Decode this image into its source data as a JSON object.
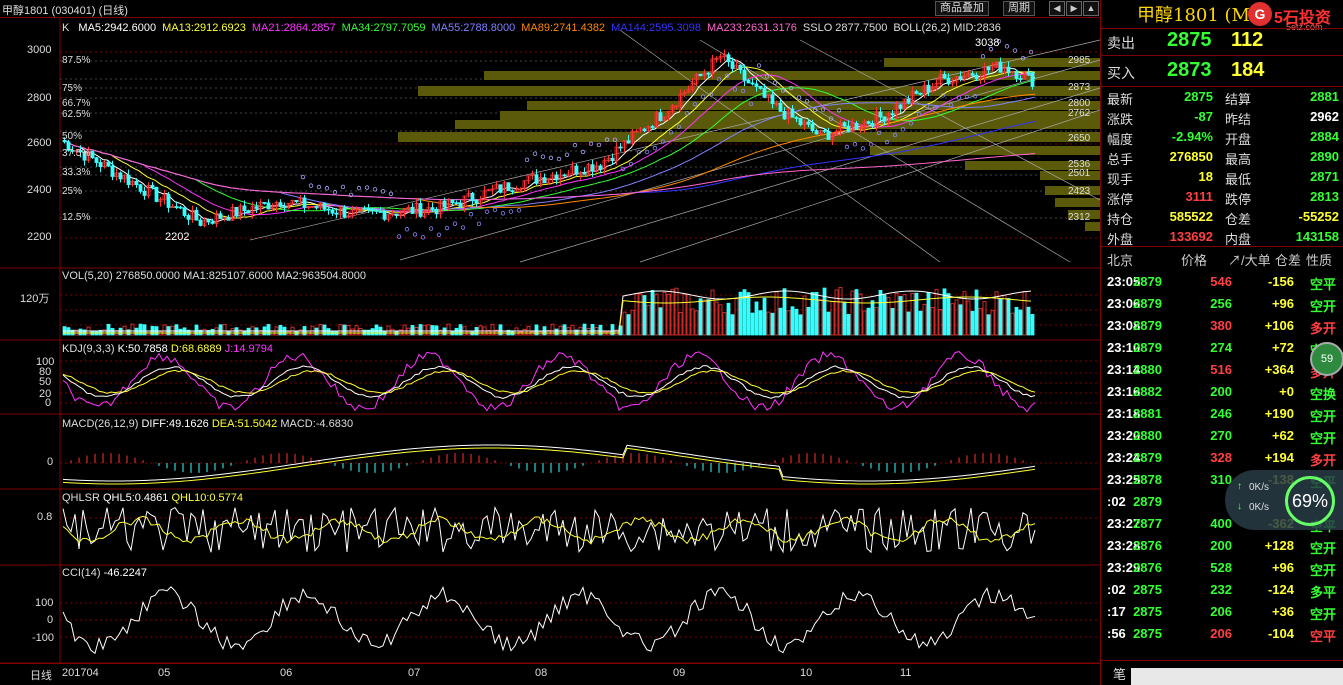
{
  "title_bar": {
    "title": "甲醇1801 (030401) (日线)",
    "buttons": [
      "商品叠加",
      "周期"
    ]
  },
  "kline": {
    "label": "K",
    "ma": [
      {
        "text": "MA5:2942.6000",
        "color": "#ffffff"
      },
      {
        "text": "MA13:2912.6923",
        "color": "#ffff33"
      },
      {
        "text": "MA21:2864.2857",
        "color": "#ff33ff"
      },
      {
        "text": "MA34:2797.7059",
        "color": "#33ff33"
      },
      {
        "text": "MA55:2788.8000",
        "color": "#8080ff"
      },
      {
        "text": "MA89:2741.4382",
        "color": "#ff8800"
      },
      {
        "text": "MA144:2595.3098",
        "color": "#3333ff"
      },
      {
        "text": "MA233:2631.3176",
        "color": "#ff66cc"
      },
      {
        "text": "SSLO 2877.7500",
        "color": "#dddddd"
      },
      {
        "text": "BOLL(26,2) MID:2836",
        "color": "#dddddd"
      }
    ],
    "y_labels": [
      "3000",
      "2800",
      "2600",
      "2400",
      "2200"
    ],
    "pct_labels": [
      "87.5%",
      "75%",
      "66.7%",
      "62.5%",
      "50%",
      "37.5%",
      "33.3%",
      "25%",
      "12.5%"
    ],
    "price_levels": [
      "2985",
      "2873",
      "2800",
      "2762",
      "2650",
      "2536",
      "2501",
      "2423",
      "2312"
    ],
    "high_mark": "3038",
    "low_mark": "2202"
  },
  "vol": {
    "header": "VOL(5,20)  276850.0000  MA1:825107.6000  MA2:963504.8000",
    "y_label": "120万"
  },
  "kdj": {
    "label": "KDJ(9,3,3)",
    "k": "K:50.7858",
    "d": "D:68.6889",
    "j": "J:14.9794",
    "y_labels": [
      "100",
      "80",
      "50",
      "20",
      "0"
    ]
  },
  "macd": {
    "label": "MACD(26,12,9)",
    "diff": "DIFF:49.1626",
    "dea": "DEA:51.5042",
    "macd": "MACD:-4.6830",
    "y_label": "0"
  },
  "qhlsr": {
    "label": "QHLSR",
    "q5": "QHL5:0.4861",
    "q10": "QHL10:0.5774",
    "y_label": "0.8"
  },
  "cci": {
    "label": "CCI(14)",
    "value": "-46.2247",
    "y_labels": [
      "100",
      "0",
      "-100"
    ]
  },
  "bottom_bar": {
    "period": "日线",
    "x_labels": [
      "201704",
      "05",
      "06",
      "07",
      "08",
      "09",
      "10",
      "11"
    ]
  },
  "quote": {
    "title": "甲醇1801 (M",
    "brand": "5石投资",
    "brand_site": "5etz.com",
    "ask": {
      "label": "卖出",
      "price": "2875",
      "vol": "112"
    },
    "bid": {
      "label": "买入",
      "price": "2873",
      "vol": "184"
    },
    "stats": [
      {
        "l1": "最新",
        "v1": "2875",
        "c1": "green",
        "l2": "结算",
        "v2": "2881",
        "c2": "green"
      },
      {
        "l1": "涨跌",
        "v1": "-87",
        "c1": "green",
        "l2": "昨结",
        "v2": "2962",
        "c2": "white"
      },
      {
        "l1": "幅度",
        "v1": "-2.94%",
        "c1": "green",
        "l2": "开盘",
        "v2": "2884",
        "c2": "green"
      },
      {
        "l1": "总手",
        "v1": "276850",
        "c1": "yellow",
        "l2": "最高",
        "v2": "2890",
        "c2": "green"
      },
      {
        "l1": "现手",
        "v1": "18",
        "c1": "yellow",
        "l2": "最低",
        "v2": "2871",
        "c2": "green"
      },
      {
        "l1": "涨停",
        "v1": "3111",
        "c1": "red",
        "l2": "跌停",
        "v2": "2813",
        "c2": "green"
      },
      {
        "l1": "持仓",
        "v1": "585522",
        "c1": "yellow",
        "l2": "仓差",
        "v2": "-55252",
        "c2": "yellow"
      },
      {
        "l1": "外盘",
        "v1": "133692",
        "c1": "red",
        "l2": "内盘",
        "v2": "143158",
        "c2": "green"
      }
    ],
    "trade_headers": [
      "北京",
      "价格",
      "↗/大单",
      "仓差",
      "性质"
    ],
    "trades": [
      {
        "t": "23:05",
        "p": "2879",
        "v": "546",
        "vc": "red",
        "d": "-156",
        "n": "空平",
        "nc": "green"
      },
      {
        "t": "23:06",
        "p": "2879",
        "v": "256",
        "vc": "green",
        "d": "+96",
        "n": "空开",
        "nc": "green"
      },
      {
        "t": "23:08",
        "p": "2879",
        "v": "380",
        "vc": "red",
        "d": "+106",
        "n": "多开",
        "nc": "red"
      },
      {
        "t": "23:10",
        "p": "2879",
        "v": "274",
        "vc": "green",
        "d": "+72",
        "n": "空开",
        "nc": "green"
      },
      {
        "t": "23:14",
        "p": "2880",
        "v": "516",
        "vc": "red",
        "d": "+364",
        "n": "多开",
        "nc": "red"
      },
      {
        "t": "23:16",
        "p": "2882",
        "v": "200",
        "vc": "green",
        "d": "+0",
        "n": "空换",
        "nc": "green"
      },
      {
        "t": "23:18",
        "p": "2881",
        "v": "246",
        "vc": "green",
        "d": "+190",
        "n": "空开",
        "nc": "green"
      },
      {
        "t": "23:20",
        "p": "2880",
        "v": "270",
        "vc": "green",
        "d": "+62",
        "n": "空开",
        "nc": "green"
      },
      {
        "t": "23:24",
        "p": "2879",
        "v": "328",
        "vc": "red",
        "d": "+194",
        "n": "多开",
        "nc": "red"
      },
      {
        "t": "23:25",
        "p": "2878",
        "v": "310",
        "vc": "green",
        "d": "-138",
        "n": "空平",
        "nc": "green"
      },
      {
        "t": ":02",
        "p": "2879",
        "v": "",
        "vc": "green",
        "d": "",
        "n": "",
        "nc": "green"
      },
      {
        "t": "23:27",
        "p": "2877",
        "v": "400",
        "vc": "green",
        "d": "-362",
        "n": "空平",
        "nc": "green"
      },
      {
        "t": "23:28",
        "p": "2876",
        "v": "200",
        "vc": "green",
        "d": "+128",
        "n": "空开",
        "nc": "green"
      },
      {
        "t": "23:29",
        "p": "2876",
        "v": "528",
        "vc": "green",
        "d": "+96",
        "n": "空开",
        "nc": "green"
      },
      {
        "t": ":02",
        "p": "2875",
        "v": "232",
        "vc": "green",
        "d": "-124",
        "n": "多平",
        "nc": "green"
      },
      {
        "t": ":17",
        "p": "2875",
        "v": "206",
        "vc": "green",
        "d": "+36",
        "n": "空开",
        "nc": "green"
      },
      {
        "t": ":56",
        "p": "2875",
        "v": "206",
        "vc": "red",
        "d": "-104",
        "n": "空平",
        "nc": "red"
      }
    ],
    "footer": "笔"
  },
  "overlay": {
    "badge": "59",
    "up_speed": "0K/s",
    "down_speed": "0K/s",
    "percent": "69%"
  }
}
